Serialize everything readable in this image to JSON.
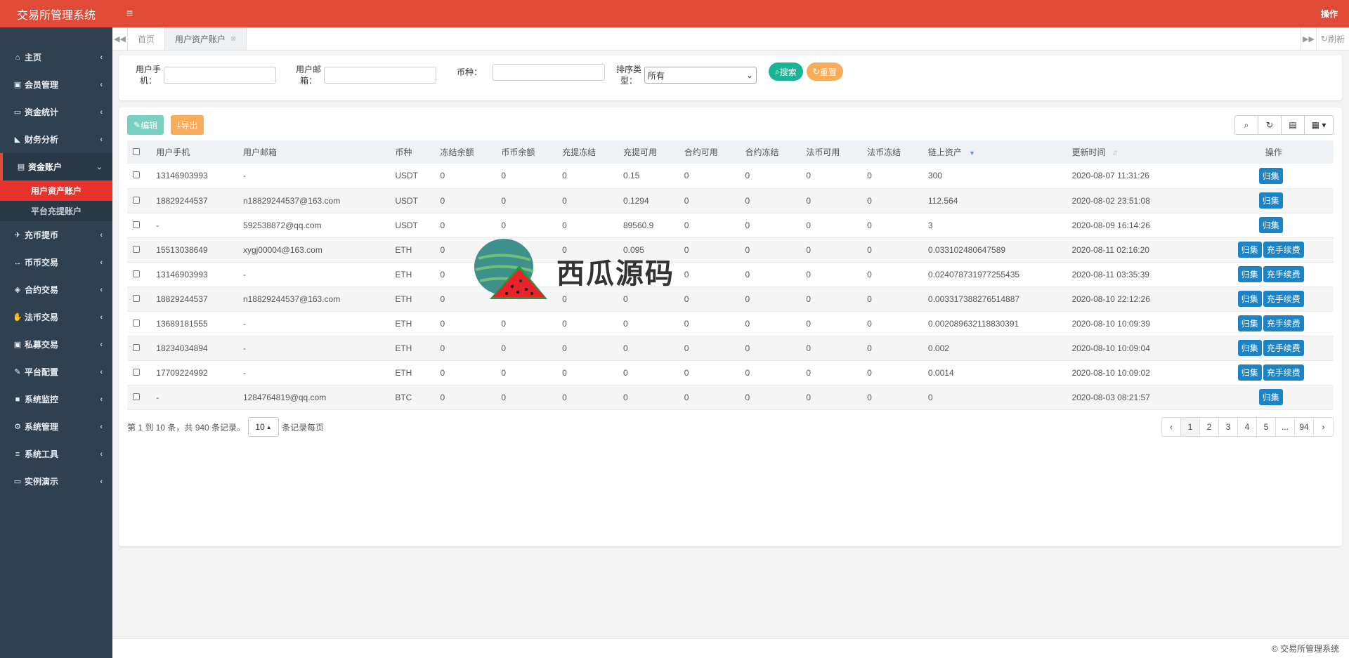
{
  "app": {
    "title": "交易所管理系统",
    "ops": "操作",
    "footer": "© 交易所管理系统"
  },
  "sidebar": {
    "items": [
      {
        "label": "主页",
        "icon": "home-icon",
        "glyph": "⌂"
      },
      {
        "label": "会员管理",
        "icon": "user-card-icon",
        "glyph": "▣"
      },
      {
        "label": "资金统计",
        "icon": "money-icon",
        "glyph": "▭"
      },
      {
        "label": "财务分析",
        "icon": "area-chart-icon",
        "glyph": "◣"
      },
      {
        "label": "资金账户",
        "icon": "calculator-icon",
        "glyph": "▤"
      },
      {
        "label": "充币提币",
        "icon": "plane-icon",
        "glyph": "✈"
      },
      {
        "label": "币币交易",
        "icon": "exchange-icon",
        "glyph": "↔"
      },
      {
        "label": "合约交易",
        "icon": "contract-icon",
        "glyph": "◈"
      },
      {
        "label": "法币交易",
        "icon": "handshake-icon",
        "glyph": "✋"
      },
      {
        "label": "私募交易",
        "icon": "user-card-icon",
        "glyph": "▣"
      },
      {
        "label": "平台配置",
        "icon": "wrench-icon",
        "glyph": "✎"
      },
      {
        "label": "系统监控",
        "icon": "video-icon",
        "glyph": "■"
      },
      {
        "label": "系统管理",
        "icon": "gear-icon",
        "glyph": "⚙"
      },
      {
        "label": "系统工具",
        "icon": "bars-icon",
        "glyph": "≡"
      },
      {
        "label": "实例演示",
        "icon": "desktop-icon",
        "glyph": "▭"
      }
    ],
    "submenu": [
      "用户资产账户",
      "平台充提账户"
    ]
  },
  "tabs": {
    "home": "首页",
    "current": "用户资产账户",
    "refresh": "刷新"
  },
  "search": {
    "phone_label": "用户手机：",
    "email_label": "用户邮箱：",
    "coin_label": "币种：",
    "sort_label": "排序类型：",
    "sort_value": "所有",
    "search_btn": "搜索",
    "reset_btn": "重置"
  },
  "toolbar": {
    "edit": "编辑",
    "export": "导出"
  },
  "table": {
    "headers": [
      "用户手机",
      "用户邮箱",
      "币种",
      "冻结余额",
      "币币余额",
      "充提冻结",
      "充提可用",
      "合约可用",
      "合约冻结",
      "法币可用",
      "法币冻结",
      "链上资产",
      "更新时间",
      "操作"
    ],
    "rows": [
      {
        "phone": "13146903993",
        "email": "-",
        "coin": "USDT",
        "c1": "0",
        "c2": "0",
        "c3": "0",
        "c4": "0.15",
        "c5": "0",
        "c6": "0",
        "c7": "0",
        "c8": "0",
        "chain": "300",
        "time": "2020-08-07 11:31:26",
        "ops": [
          "归集"
        ]
      },
      {
        "phone": "18829244537",
        "email": "n18829244537@163.com",
        "coin": "USDT",
        "c1": "0",
        "c2": "0",
        "c3": "0",
        "c4": "0.1294",
        "c5": "0",
        "c6": "0",
        "c7": "0",
        "c8": "0",
        "chain": "112.564",
        "time": "2020-08-02 23:51:08",
        "ops": [
          "归集"
        ]
      },
      {
        "phone": "-",
        "email": "592538872@qq.com",
        "coin": "USDT",
        "c1": "0",
        "c2": "0",
        "c3": "0",
        "c4": "89560.9",
        "c5": "0",
        "c6": "0",
        "c7": "0",
        "c8": "0",
        "chain": "3",
        "time": "2020-08-09 16:14:26",
        "ops": [
          "归集"
        ]
      },
      {
        "phone": "15513038649",
        "email": "xygj00004@163.com",
        "coin": "ETH",
        "c1": "0",
        "c2": "",
        "c3": "0",
        "c4": "0.095",
        "c5": "0",
        "c6": "0",
        "c7": "0",
        "c8": "0",
        "chain": "0.033102480647589",
        "time": "2020-08-11 02:16:20",
        "ops": [
          "归集",
          "充手续费"
        ]
      },
      {
        "phone": "13146903993",
        "email": "-",
        "coin": "ETH",
        "c1": "0",
        "c2": "",
        "c3": "",
        "c4": "",
        "c5": "0",
        "c6": "0",
        "c7": "0",
        "c8": "0",
        "chain": "0.024078731977255435",
        "time": "2020-08-11 03:35:39",
        "ops": [
          "归集",
          "充手续费"
        ]
      },
      {
        "phone": "18829244537",
        "email": "n18829244537@163.com",
        "coin": "ETH",
        "c1": "0",
        "c2": "",
        "c3": "0",
        "c4": "0",
        "c5": "0",
        "c6": "0",
        "c7": "0",
        "c8": "0",
        "chain": "0.003317388276514887",
        "time": "2020-08-10 22:12:26",
        "ops": [
          "归集",
          "充手续费"
        ]
      },
      {
        "phone": "13689181555",
        "email": "-",
        "coin": "ETH",
        "c1": "0",
        "c2": "0",
        "c3": "0",
        "c4": "0",
        "c5": "0",
        "c6": "0",
        "c7": "0",
        "c8": "0",
        "chain": "0.002089632118830391",
        "time": "2020-08-10 10:09:39",
        "ops": [
          "归集",
          "充手续费"
        ]
      },
      {
        "phone": "18234034894",
        "email": "-",
        "coin": "ETH",
        "c1": "0",
        "c2": "0",
        "c3": "0",
        "c4": "0",
        "c5": "0",
        "c6": "0",
        "c7": "0",
        "c8": "0",
        "chain": "0.002",
        "time": "2020-08-10 10:09:04",
        "ops": [
          "归集",
          "充手续费"
        ]
      },
      {
        "phone": "17709224992",
        "email": "-",
        "coin": "ETH",
        "c1": "0",
        "c2": "0",
        "c3": "0",
        "c4": "0",
        "c5": "0",
        "c6": "0",
        "c7": "0",
        "c8": "0",
        "chain": "0.0014",
        "time": "2020-08-10 10:09:02",
        "ops": [
          "归集",
          "充手续费"
        ]
      },
      {
        "phone": "-",
        "email": "1284764819@qq.com",
        "coin": "BTC",
        "c1": "0",
        "c2": "0",
        "c3": "0",
        "c4": "0",
        "c5": "0",
        "c6": "0",
        "c7": "0",
        "c8": "0",
        "chain": "0",
        "time": "2020-08-03 08:21:57",
        "ops": [
          "归集"
        ]
      }
    ]
  },
  "pager": {
    "info": "第 1 到 10 条，共 940 条记录。",
    "page_size": "10",
    "per_page": "条记录每页",
    "pages": [
      "‹",
      "1",
      "2",
      "3",
      "4",
      "5",
      "...",
      "94",
      "›"
    ]
  },
  "watermark": {
    "text": "西瓜源码"
  }
}
